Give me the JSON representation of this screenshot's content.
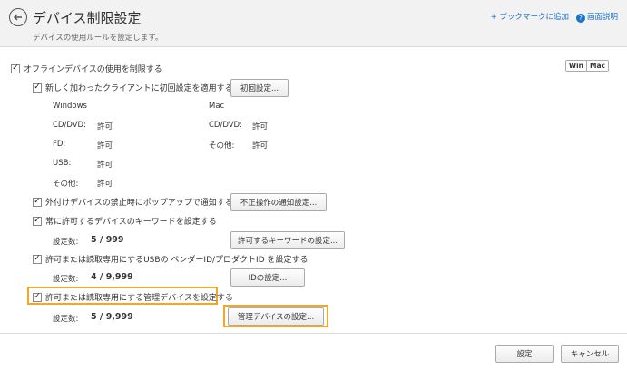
{
  "header": {
    "title": "デバイス制限設定",
    "subtitle": "デバイスの使用ルールを設定します。",
    "bookmark_link": "+ ブックマークに追加",
    "help_link": "画面説明"
  },
  "os_toggle": {
    "win": "Win",
    "mac": "Mac"
  },
  "main_option": {
    "label": "オフラインデバイスの使用を制限する",
    "checked": true
  },
  "initial_setting": {
    "label": "新しく加わったクライアントに初回設定を適用する",
    "checked": true,
    "button": "初回設定..."
  },
  "windows": {
    "heading": "Windows",
    "rows": [
      {
        "name": "CD/DVD:",
        "value": "許可"
      },
      {
        "name": "FD:",
        "value": "許可"
      },
      {
        "name": "USB:",
        "value": "許可"
      },
      {
        "name": "その他:",
        "value": "許可"
      }
    ]
  },
  "mac": {
    "heading": "Mac",
    "rows": [
      {
        "name": "CD/DVD:",
        "value": "許可"
      },
      {
        "name": "その他:",
        "value": "許可"
      }
    ]
  },
  "popup_notify": {
    "label": "外付けデバイスの禁止時にポップアップで通知する",
    "checked": true,
    "button": "不正操作の通知設定..."
  },
  "keyword": {
    "label": "常に許可するデバイスのキーワードを設定する",
    "checked": true,
    "count_label": "設定数:",
    "count_value": "5 / 999",
    "button": "許可するキーワードの設定..."
  },
  "vendor_id": {
    "label": "許可または読取専用にするUSBの ベンダーID/プロダクトID を設定する",
    "checked": true,
    "count_label": "設定数:",
    "count_value": "4 / 9,999",
    "button": "IDの設定..."
  },
  "managed_device": {
    "label": "許可または読取専用にする管理デバイスを設定する",
    "checked": true,
    "count_label": "設定数:",
    "count_value": "5 / 9,999",
    "button": "管理デバイスの設定..."
  },
  "footer": {
    "ok": "設定",
    "cancel": "キャンセル"
  },
  "colors": {
    "accent": "#f5a623",
    "link": "#1a73c8"
  }
}
